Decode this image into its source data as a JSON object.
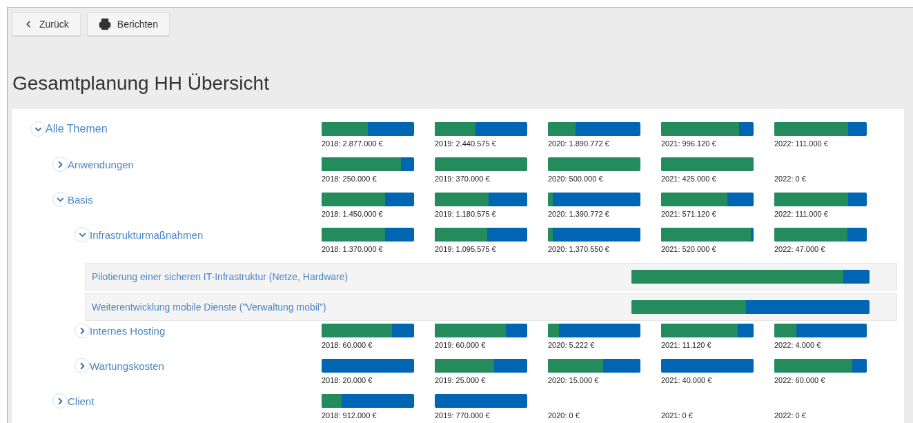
{
  "toolbar": {
    "buttons": [
      {
        "kind": "back",
        "label": "Zurück"
      },
      {
        "kind": "print",
        "label": "Berichten"
      }
    ]
  },
  "title": "Gesamtplanung HH Übersicht",
  "tree": [
    {
      "kind": "node",
      "label": "Alle Themen",
      "expanded": true,
      "years": [
        {
          "label": "2018: 2.877.000 €",
          "level": 0.5
        },
        {
          "label": "2019: 2.440.575 €",
          "level": 0.44
        },
        {
          "label": "2020: 1.890.772 €",
          "level": 0.3
        },
        {
          "label": "2021: 996.120 €",
          "level": 0.84
        },
        {
          "label": "2022: 111.000 €",
          "level": 0.8
        }
      ],
      "children": [
        {
          "kind": "node",
          "label": "Anwendungen",
          "expanded": false,
          "years": [
            {
              "label": "2018: 250.000 €",
              "level": 0.86
            },
            {
              "label": "2019: 370.000 €",
              "level": 1
            },
            {
              "label": "2020: 500.000 €",
              "level": 1
            },
            {
              "label": "2021: 425.000 €",
              "level": 1
            },
            {
              "label": "2022: 0 €"
            }
          ]
        },
        {
          "kind": "node",
          "label": "Basis",
          "expanded": true,
          "years": [
            {
              "label": "2018: 1.450.000 €",
              "level": 0.69
            },
            {
              "label": "2019: 1.180.575 €",
              "level": 0.58
            },
            {
              "label": "2020: 1.390.772 €",
              "level": 0.05
            },
            {
              "label": "2021: 571.120 €",
              "level": 0.72
            },
            {
              "label": "2022: 111.000 €",
              "level": 0.8
            }
          ],
          "children": [
            {
              "kind": "node",
              "label": "Infrastrukturmaßnahmen",
              "expanded": true,
              "years": [
                {
                  "label": "2018: 1.370.000 €",
                  "level": 0.69
                },
                {
                  "label": "2019: 1.095.575 €",
                  "level": 0.57
                },
                {
                  "label": "2020: 1.370.550 €",
                  "level": 0.05
                },
                {
                  "label": "2021: 520.000 €",
                  "level": 0.97
                },
                {
                  "label": "2022: 47.000 €",
                  "level": 0.79
                }
              ],
              "children": [
                {
                  "kind": "project",
                  "label": "Pilotierung einer sicheren IT-Infrastruktur (Netze, Hardware)",
                  "level": 0.89
                },
                {
                  "kind": "project",
                  "label": "Weiterentwicklung mobile Dienste (\"Verwaltung mobil\")",
                  "level": 0.48
                }
              ]
            },
            {
              "kind": "node",
              "label": "Internes Hosting",
              "expanded": false,
              "years": [
                {
                  "label": "2018: 60.000 €",
                  "level": 0.76
                },
                {
                  "label": "2019: 60.000 €",
                  "level": 0.77
                },
                {
                  "label": "2020: 5.222 €",
                  "level": 0.12
                },
                {
                  "label": "2021: 11.120 €",
                  "level": 0.83
                },
                {
                  "label": "2022: 4.000 €",
                  "level": 0.24
                }
              ]
            },
            {
              "kind": "node",
              "label": "Wartungskosten",
              "expanded": false,
              "years": [
                {
                  "label": "2018: 20.000 €",
                  "level": 0
                },
                {
                  "label": "2019: 25.000 €",
                  "level": 0.64
                },
                {
                  "label": "2020: 15.000 €",
                  "level": 0.6
                },
                {
                  "label": "2021: 40.000 €",
                  "level": 0
                },
                {
                  "label": "2022: 60.000 €",
                  "level": 0.84
                }
              ]
            }
          ]
        },
        {
          "kind": "node",
          "label": "Client",
          "expanded": false,
          "years": [
            {
              "label": "2018: 912.000 €",
              "level": 0.22
            },
            {
              "label": "2019: 770.000 €",
              "level": 0
            },
            {
              "label": "2020: 0 €"
            },
            {
              "label": "2021: 0 €"
            },
            {
              "label": "2022: 0 €"
            }
          ]
        }
      ]
    }
  ]
}
